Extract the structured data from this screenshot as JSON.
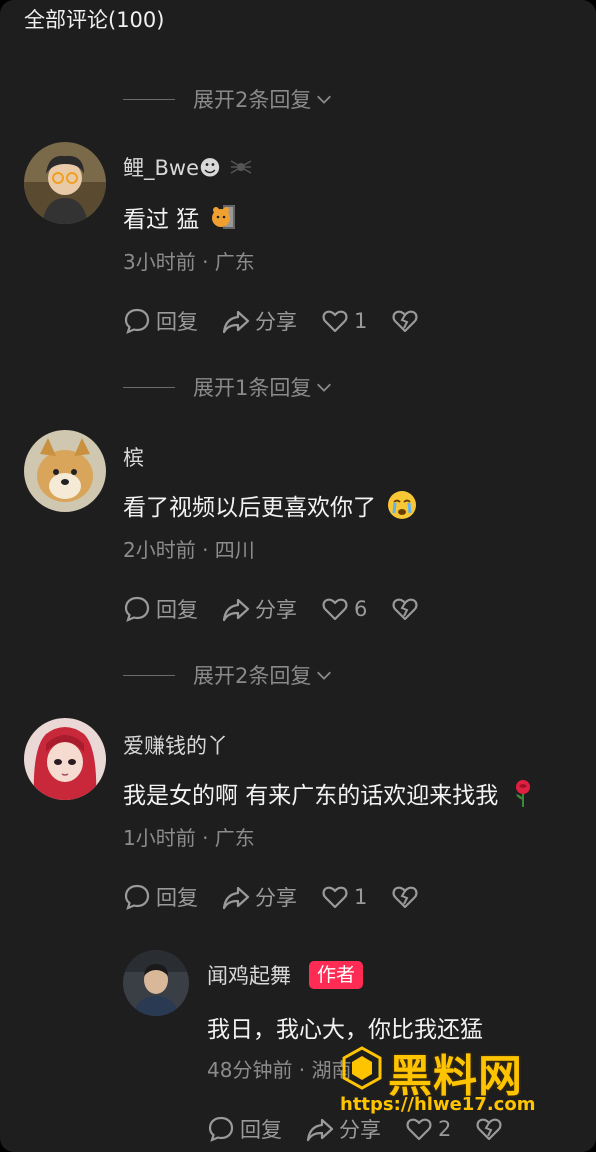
{
  "header": {
    "title": "全部评论(100)"
  },
  "expand_labels": [
    "展开2条回复",
    "展开1条回复",
    "展开2条回复"
  ],
  "comments": [
    {
      "username": "鲤_Bwe☻",
      "text": "看过 猛",
      "meta": "3小时前 · 广东",
      "likes": "1",
      "reply_label": "回复",
      "share_label": "分享"
    },
    {
      "username": "槟",
      "text": "看了视频以后更喜欢你了",
      "meta": "2小时前 · 四川",
      "likes": "6",
      "reply_label": "回复",
      "share_label": "分享"
    },
    {
      "username": "爱赚钱的丫",
      "text": "我是女的啊 有来广东的话欢迎来找我",
      "meta": "1小时前 · 广东",
      "likes": "1",
      "reply_label": "回复",
      "share_label": "分享"
    }
  ],
  "reply": {
    "username": "闻鸡起舞",
    "badge": "作者",
    "text": "我日，我心大，你比我还猛",
    "meta": "48分钟前 · 湖南",
    "likes": "2",
    "reply_label": "回复",
    "share_label": "分享"
  },
  "watermark": {
    "title": "黑料网",
    "url": "https://hlwe17.com"
  },
  "colors": {
    "background": "#1e1e1e",
    "author_badge": "#fe2c55",
    "watermark": "#ffc400"
  }
}
